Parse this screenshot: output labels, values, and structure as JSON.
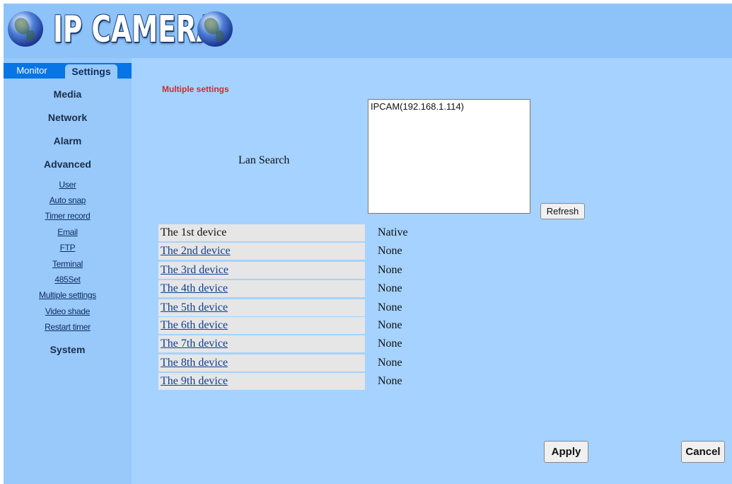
{
  "header": {
    "logo_text": "IP CAMERA"
  },
  "tabs": {
    "monitor": "Monitor",
    "settings": "Settings"
  },
  "sidebar": {
    "media": "Media",
    "network": "Network",
    "alarm": "Alarm",
    "advanced": "Advanced",
    "links": [
      "User",
      "Auto snap",
      "Timer record",
      "Email",
      "FTP",
      "Terminal",
      "485Set",
      "Multiple settings",
      "Video shade",
      "Restart timer"
    ],
    "system": "System"
  },
  "main": {
    "section_title": "Multiple settings",
    "lan_search_label": "Lan Search",
    "device_list_items": [
      "IPCAM(192.168.1.114)"
    ],
    "refresh_label": "Refresh",
    "devices": [
      {
        "name": "The 1st device",
        "status": "Native"
      },
      {
        "name": "The 2nd device",
        "status": "None"
      },
      {
        "name": "The 3rd device",
        "status": "None"
      },
      {
        "name": "The 4th device",
        "status": "None"
      },
      {
        "name": "The 5th device",
        "status": "None"
      },
      {
        "name": "The 6th device",
        "status": "None"
      },
      {
        "name": "The 7th device",
        "status": "None"
      },
      {
        "name": "The 8th device",
        "status": "None"
      },
      {
        "name": "The 9th device",
        "status": "None"
      }
    ],
    "apply_label": "Apply",
    "cancel_label": "Cancel"
  },
  "colors": {
    "header_bg": "#8ec3fa",
    "sidebar_bg": "#99c9fb",
    "main_bg": "#a5d2fe",
    "tab_bar": "#0775e6",
    "section_title": "#d22b2b",
    "link": "#0f3f91"
  }
}
